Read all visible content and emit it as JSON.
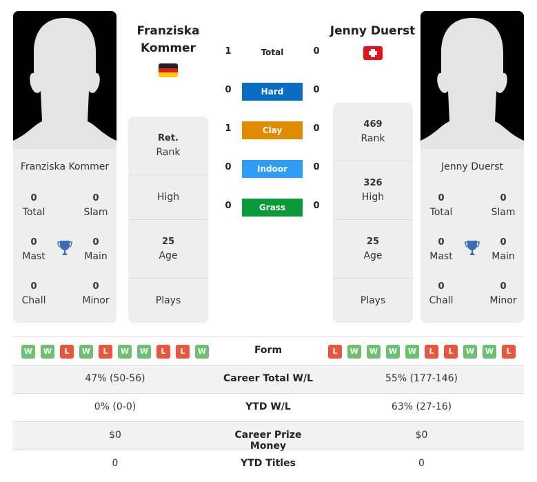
{
  "player1": {
    "name": "Franziska Kommer",
    "name_line1": "Franziska",
    "name_line2": "Kommer",
    "country": "Germany",
    "flag_icon": "germany-flag-icon",
    "titles": {
      "total": {
        "value": "0",
        "label": "Total"
      },
      "slam": {
        "value": "0",
        "label": "Slam"
      },
      "mast": {
        "value": "0",
        "label": "Mast"
      },
      "main": {
        "value": "0",
        "label": "Main"
      },
      "chall": {
        "value": "0",
        "label": "Chall"
      },
      "minor": {
        "value": "0",
        "label": "Minor"
      }
    },
    "info": {
      "rank": {
        "value": "Ret.",
        "label": "Rank"
      },
      "high": {
        "value": "",
        "label": "High"
      },
      "age": {
        "value": "25",
        "label": "Age"
      },
      "plays": {
        "value": "",
        "label": "Plays"
      }
    }
  },
  "player2": {
    "name": "Jenny Duerst",
    "country": "Switzerland",
    "flag_icon": "switzerland-flag-icon",
    "titles": {
      "total": {
        "value": "0",
        "label": "Total"
      },
      "slam": {
        "value": "0",
        "label": "Slam"
      },
      "mast": {
        "value": "0",
        "label": "Mast"
      },
      "main": {
        "value": "0",
        "label": "Main"
      },
      "chall": {
        "value": "0",
        "label": "Chall"
      },
      "minor": {
        "value": "0",
        "label": "Minor"
      }
    },
    "info": {
      "rank": {
        "value": "469",
        "label": "Rank"
      },
      "high": {
        "value": "326",
        "label": "High"
      },
      "age": {
        "value": "25",
        "label": "Age"
      },
      "plays": {
        "value": "",
        "label": "Plays"
      }
    }
  },
  "h2h": {
    "total": {
      "label": "Total",
      "p1": "1",
      "p2": "0"
    },
    "surfaces": [
      {
        "label": "Hard",
        "p1": "0",
        "p2": "0",
        "color": "#0a6cc2"
      },
      {
        "label": "Clay",
        "p1": "1",
        "p2": "0",
        "color": "#e08c00"
      },
      {
        "label": "Indoor",
        "p1": "0",
        "p2": "0",
        "color": "#2e9df5"
      },
      {
        "label": "Grass",
        "p1": "0",
        "p2": "0",
        "color": "#0a9a3a"
      }
    ]
  },
  "comparison": {
    "form": {
      "label": "Form",
      "p1": [
        "W",
        "W",
        "L",
        "W",
        "L",
        "W",
        "W",
        "L",
        "L",
        "W"
      ],
      "p2": [
        "L",
        "W",
        "W",
        "W",
        "W",
        "L",
        "L",
        "W",
        "W",
        "L"
      ]
    },
    "rows": [
      {
        "label": "Career Total W/L",
        "p1": "47% (50-56)",
        "p2": "55% (177-146)"
      },
      {
        "label": "YTD W/L",
        "p1": "0% (0-0)",
        "p2": "63% (27-16)"
      },
      {
        "label": "Career Prize Money",
        "p1": "$0",
        "p2": "$0"
      },
      {
        "label": "YTD Titles",
        "p1": "0",
        "p2": "0"
      }
    ]
  },
  "colors": {
    "win": "#6fbf73",
    "loss": "#e8563f",
    "trophy": "#3a6fb8"
  }
}
